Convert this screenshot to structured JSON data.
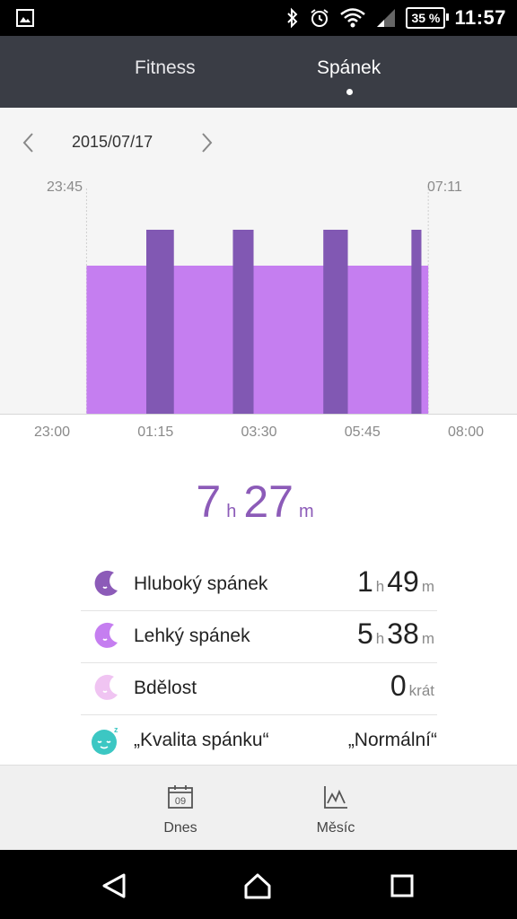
{
  "status_bar": {
    "time": "11:57",
    "battery": "35 %"
  },
  "tabs": [
    {
      "label": "Fitness",
      "active": false
    },
    {
      "label": "Spánek",
      "active": true
    }
  ],
  "date": "2015/07/17",
  "sleep_window": {
    "start": "23:45",
    "end": "07:11"
  },
  "chart_data": {
    "type": "area",
    "x_ticks": [
      "23:00",
      "01:15",
      "03:30",
      "05:45",
      "08:00"
    ],
    "x_range_minutes": [
      0,
      540
    ],
    "light_sleep_span_minutes": [
      45,
      491
    ],
    "deep_sleep_segments_minutes": [
      [
        123,
        159
      ],
      [
        236,
        263
      ],
      [
        354,
        386
      ],
      [
        469,
        482
      ]
    ],
    "colors": {
      "light": "#c57ef0",
      "deep": "#8158b3"
    }
  },
  "total": {
    "hours": "7",
    "hours_unit": "h",
    "minutes": "27",
    "minutes_unit": "m"
  },
  "stats": [
    {
      "label": "Hluboký spánek",
      "h": "1",
      "h_unit": "h",
      "m": "49",
      "m_unit": "m",
      "icon": "deep-sleep-moon-icon",
      "color": "#8c5bb8"
    },
    {
      "label": "Lehký spánek",
      "h": "5",
      "h_unit": "h",
      "m": "38",
      "m_unit": "m",
      "icon": "light-sleep-moon-icon",
      "color": "#c57ef0"
    },
    {
      "label": "Bdělost",
      "count": "0",
      "count_unit": "krát",
      "icon": "awake-moon-icon",
      "color": "#f0c4f2"
    },
    {
      "label": "„Kvalita spánku“",
      "value": "„Normální“",
      "icon": "sleep-quality-face-icon",
      "color": "#3cc7c3"
    }
  ],
  "bottom_nav": [
    {
      "label": "Dnes",
      "icon": "calendar-icon",
      "calendar_day": "09"
    },
    {
      "label": "Měsíc",
      "icon": "line-chart-icon"
    }
  ]
}
